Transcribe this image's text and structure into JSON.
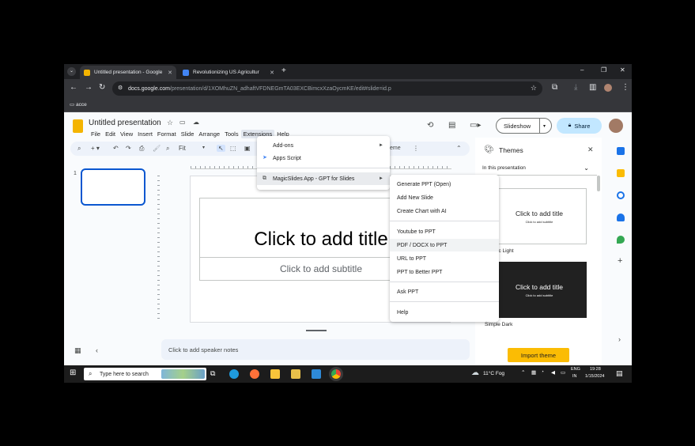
{
  "browser": {
    "tabs": [
      {
        "title": "Untitled presentation - Google",
        "active": true,
        "color": "#f4b400"
      },
      {
        "title": "Revolutionizing US Agricultur",
        "active": false,
        "color": "#4285f4"
      }
    ],
    "new_tab": "+",
    "url_host": "docs.google.com",
    "url_path": "/presentation/d/1XOMhuZN_adhaftVFDNEGmTA03EXCBimcxXzaOycmKE/edit#slide=id.p",
    "bookmark_label": "acce"
  },
  "app": {
    "doc_title": "Untitled presentation",
    "menus": [
      "File",
      "Edit",
      "View",
      "Insert",
      "Format",
      "Slide",
      "Arrange",
      "Tools",
      "Extensions",
      "Help"
    ],
    "zoom_label": "Fit",
    "theme_btn_label": "eme",
    "slide_number": "1",
    "slide_title_placeholder": "Click to add title",
    "slide_subtitle_placeholder": "Click to add subtitle",
    "notes_placeholder": "Click to add speaker notes",
    "slideshow_label": "Slideshow",
    "share_label": "Share"
  },
  "extensions_menu": {
    "items": [
      "Add-ons",
      "Apps Script",
      "MagicSlides App - GPT for Slides"
    ]
  },
  "magicslides_submenu": {
    "items": [
      "Generate PPT (Open)",
      "Add New Slide",
      "Create Chart with AI",
      "Youtube to PPT",
      "PDF / DOCX to PPT",
      "URL to PPT",
      "PPT to Better PPT",
      "Ask PPT",
      "Help"
    ]
  },
  "themes": {
    "title": "Themes",
    "filter": "In this presentation",
    "cards": [
      {
        "name": "ic Light",
        "title": "Click to add title",
        "subtitle": "Click to add subtitle"
      },
      {
        "name": "Simple Dark",
        "title": "Click to add title",
        "subtitle": "Click to add subtitle"
      }
    ],
    "import_label": "Import theme"
  },
  "taskbar": {
    "search_placeholder": "Type here to search",
    "weather": "11°C  Fog",
    "lang": "ENG",
    "region": "IN",
    "time": "19:28",
    "date": "1/15/2024"
  },
  "colors": {
    "accent": "#0b57d0",
    "share_bg": "#c2e7ff",
    "import_bg": "#fbbc04"
  }
}
